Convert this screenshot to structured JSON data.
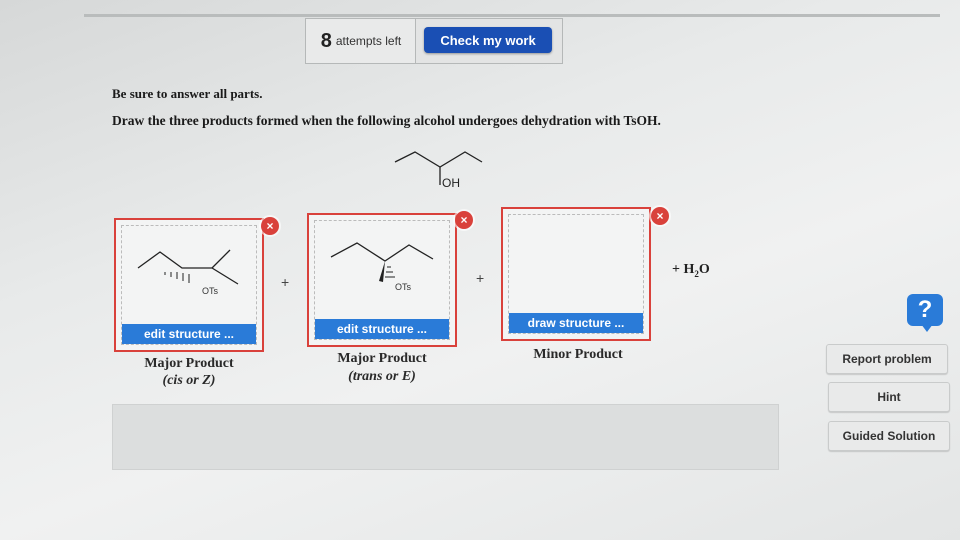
{
  "header": {
    "attempts_count": "8",
    "attempts_label": "attempts left",
    "check_label": "Check my work"
  },
  "question": {
    "instruction": "Be sure to answer all parts.",
    "prompt": "Draw the three products formed when the following alcohol undergoes dehydration with TsOH.",
    "reactant_label": "OH"
  },
  "panels": [
    {
      "button": "edit structure ...",
      "caption": "Major Product",
      "subcaption": "(cis or Z)",
      "group_label": "OTs"
    },
    {
      "button": "edit structure ...",
      "caption": "Major Product",
      "subcaption": "(trans or E)",
      "group_label": "OTs"
    },
    {
      "button": "draw structure ...",
      "caption": "Minor Product",
      "subcaption": ""
    }
  ],
  "equation": {
    "plus": "+",
    "h2o": "+ H",
    "h2o_sub": "2",
    "h2o_end": "O"
  },
  "icons": {
    "remove": "×",
    "help": "?"
  },
  "sidebar": {
    "report": "Report problem",
    "hint": "Hint",
    "guided": "Guided Solution"
  },
  "colors": {
    "accent_blue": "#1a4fb4",
    "structure_blue": "#2a7bd8",
    "panel_red": "#d9413b"
  }
}
